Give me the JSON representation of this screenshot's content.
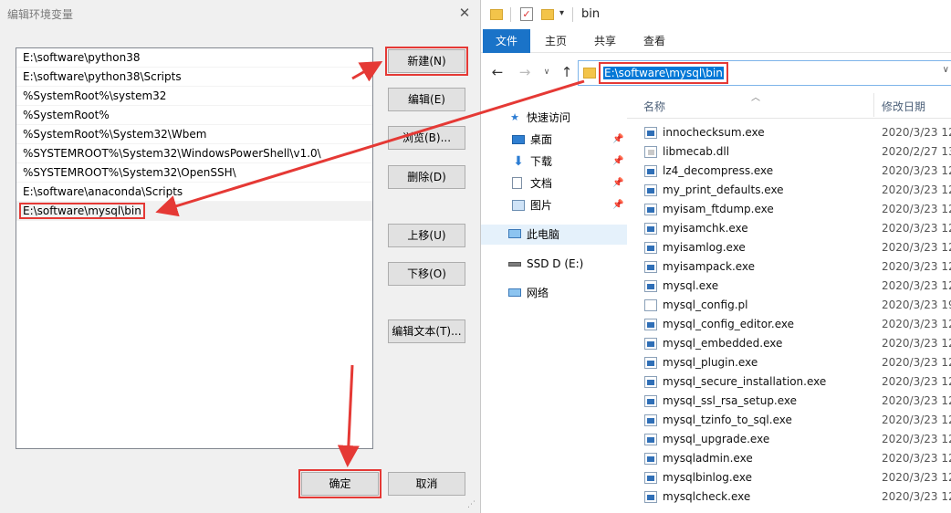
{
  "dialog": {
    "title": "编辑环境变量",
    "close": "✕",
    "paths": [
      "E:\\software\\python38",
      "E:\\software\\python38\\Scripts",
      "%SystemRoot%\\system32",
      "%SystemRoot%",
      "%SystemRoot%\\System32\\Wbem",
      "%SYSTEMROOT%\\System32\\WindowsPowerShell\\v1.0\\",
      "%SYSTEMROOT%\\System32\\OpenSSH\\",
      "E:\\software\\anaconda\\Scripts",
      "E:\\software\\mysql\\bin"
    ],
    "buttons": {
      "new": "新建(N)",
      "edit": "编辑(E)",
      "browse": "浏览(B)...",
      "delete": "删除(D)",
      "up": "上移(U)",
      "down": "下移(O)",
      "edit_text": "编辑文本(T)...",
      "ok": "确定",
      "cancel": "取消"
    }
  },
  "explorer": {
    "window_title": "bin",
    "ribbon_tabs": [
      "文件",
      "主页",
      "共享",
      "查看"
    ],
    "address": "E:\\software\\mysql\\bin",
    "nav": {
      "quick_access": "快速访问",
      "desktop": "桌面",
      "downloads": "下载",
      "documents": "文档",
      "pictures": "图片",
      "this_pc": "此电脑",
      "drive": "SSD D (E:)",
      "network": "网络"
    },
    "columns": {
      "name": "名称",
      "date": "修改日期"
    },
    "files": [
      {
        "name": "innochecksum.exe",
        "date": "2020/3/23 12",
        "kind": "exe"
      },
      {
        "name": "libmecab.dll",
        "date": "2020/2/27 13",
        "kind": "dll"
      },
      {
        "name": "lz4_decompress.exe",
        "date": "2020/3/23 12",
        "kind": "exe"
      },
      {
        "name": "my_print_defaults.exe",
        "date": "2020/3/23 12",
        "kind": "exe"
      },
      {
        "name": "myisam_ftdump.exe",
        "date": "2020/3/23 12",
        "kind": "exe"
      },
      {
        "name": "myisamchk.exe",
        "date": "2020/3/23 12",
        "kind": "exe"
      },
      {
        "name": "myisamlog.exe",
        "date": "2020/3/23 12",
        "kind": "exe"
      },
      {
        "name": "myisampack.exe",
        "date": "2020/3/23 12",
        "kind": "exe"
      },
      {
        "name": "mysql.exe",
        "date": "2020/3/23 12",
        "kind": "exe"
      },
      {
        "name": "mysql_config.pl",
        "date": "2020/3/23 19",
        "kind": "plain"
      },
      {
        "name": "mysql_config_editor.exe",
        "date": "2020/3/23 12",
        "kind": "exe"
      },
      {
        "name": "mysql_embedded.exe",
        "date": "2020/3/23 12",
        "kind": "exe"
      },
      {
        "name": "mysql_plugin.exe",
        "date": "2020/3/23 12",
        "kind": "exe"
      },
      {
        "name": "mysql_secure_installation.exe",
        "date": "2020/3/23 12",
        "kind": "exe"
      },
      {
        "name": "mysql_ssl_rsa_setup.exe",
        "date": "2020/3/23 12",
        "kind": "exe"
      },
      {
        "name": "mysql_tzinfo_to_sql.exe",
        "date": "2020/3/23 12",
        "kind": "exe"
      },
      {
        "name": "mysql_upgrade.exe",
        "date": "2020/3/23 12",
        "kind": "exe"
      },
      {
        "name": "mysqladmin.exe",
        "date": "2020/3/23 12",
        "kind": "exe"
      },
      {
        "name": "mysqlbinlog.exe",
        "date": "2020/3/23 12",
        "kind": "exe"
      },
      {
        "name": "mysqlcheck.exe",
        "date": "2020/3/23 12",
        "kind": "exe"
      }
    ]
  },
  "colors": {
    "accent": "#0078d7",
    "highlight": "#e53935",
    "ribbon_file": "#1a73c8"
  }
}
